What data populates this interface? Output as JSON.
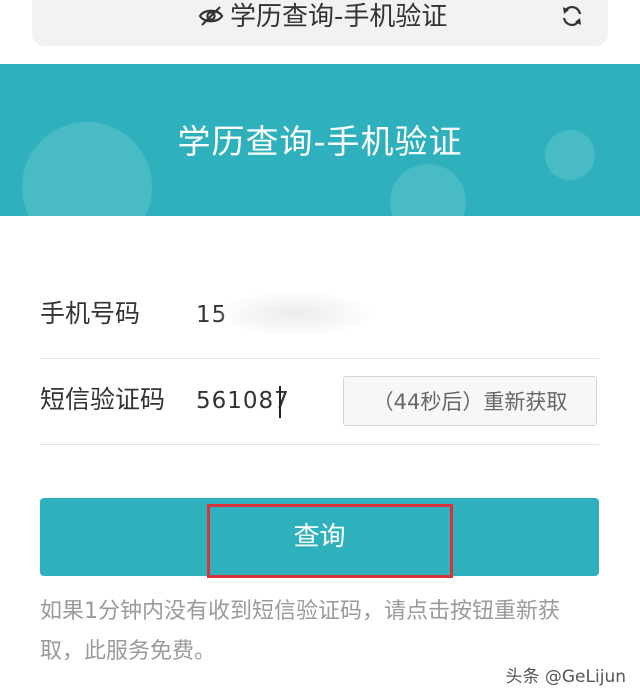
{
  "browser": {
    "title": "学历查询-手机验证",
    "privacy_icon": "eye-off-icon",
    "refresh_icon": "refresh-icon"
  },
  "banner": {
    "title": "学历查询-手机验证",
    "background_color": "#2fb1bd"
  },
  "form": {
    "phone": {
      "label": "手机号码",
      "value": "15"
    },
    "sms": {
      "label": "短信验证码",
      "value": "561087",
      "resend_label": "（44秒后）重新获取"
    },
    "submit_label": "查询",
    "accent_color": "#2fb1bd",
    "highlight_color": "#d9323a"
  },
  "help": {
    "text": "如果1分钟内没有收到短信验证码，请点击按钮重新获取，此服务免费。"
  },
  "watermark": {
    "text": "头条 @GeLijun"
  }
}
